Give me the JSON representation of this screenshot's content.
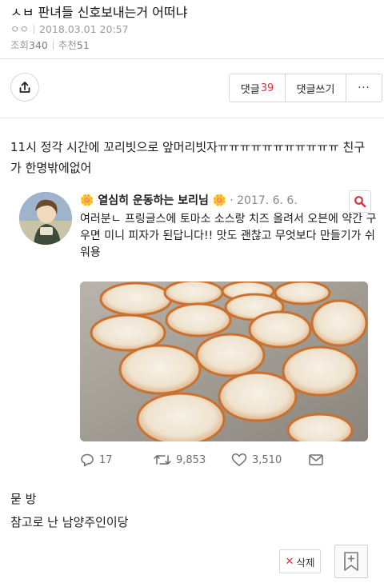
{
  "post": {
    "title": "ㅅㅂ 판녀들 신호보내는거 어떠냐",
    "author": "ㅇㅇ",
    "datetime": "2018.03.01 20:57",
    "views_label": "조회",
    "views": "340",
    "recommend_label": "추천",
    "recommend": "51"
  },
  "actions": {
    "share_icon": "share-icon",
    "comment_label": "댓글",
    "comment_count": "39",
    "write_comment_label": "댓글쓰기",
    "more_label": "···"
  },
  "body": {
    "text": "11시 정각 시간에 꼬리빗으로 앞머리빗자ㅠㅠㅠㅠㅠㅠㅠㅠㅠㅠㅠ 친구가 한명밖에없어"
  },
  "tweet": {
    "flower_left": "🌼",
    "name": "열심히 운동하는 보리님",
    "flower_right": "🌼",
    "date": "· 2017. 6. 6.",
    "search_icon": "search-icon",
    "text": "여러분ㄴ 프링글스에 토마소 소스랑 치즈 올려서 오븐에 약간 구우면 미니 피자가 된답니다!! 맛도 괜찮고 무엇보다 만들기가 쉬워용",
    "replies": "17",
    "retweets": "9,853",
    "likes": "3,510",
    "accent": "#e0323a"
  },
  "after": {
    "line1": "묻 방",
    "line2": "참고로 난 남양주인이당"
  },
  "footer": {
    "delete_x": "✕",
    "delete_label": "삭제",
    "bookmark_icon": "bookmark-icon"
  }
}
